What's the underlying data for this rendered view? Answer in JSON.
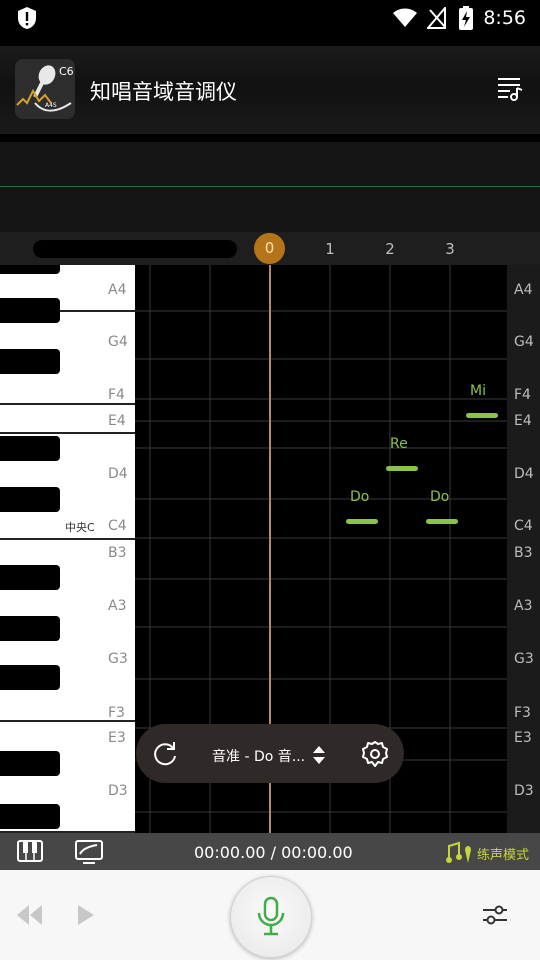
{
  "status_bar": {
    "time": "8:56"
  },
  "header": {
    "title": "知唱音域音调仪",
    "logo_text_top": "C6",
    "logo_text_bottom": "A4S"
  },
  "timeline": {
    "playhead": "0",
    "ticks": [
      "1",
      "2",
      "3"
    ]
  },
  "piano": {
    "labels": [
      "A4",
      "G4",
      "F4",
      "E4",
      "D4",
      "C4",
      "B3",
      "A3",
      "G3",
      "F3",
      "E3",
      "D3"
    ],
    "middle_c": "中央C"
  },
  "right_axis": {
    "labels": [
      "A4",
      "G4",
      "F4",
      "E4",
      "D4",
      "C4",
      "B3",
      "A3",
      "G3",
      "F3",
      "E3",
      "D3"
    ]
  },
  "notes": [
    {
      "name": "Do",
      "pitch": "C4",
      "time": 1.5
    },
    {
      "name": "Re",
      "pitch": "D4",
      "time": 2.2
    },
    {
      "name": "Do",
      "pitch": "C4",
      "time": 2.8
    },
    {
      "name": "Mi",
      "pitch": "E4",
      "time": 3.5
    }
  ],
  "float_bar": {
    "mode": "音准 - Do 音..."
  },
  "bottom_bar": {
    "timecode": "00:00.00 / 00:00.00",
    "practice_mode": "练声模式"
  },
  "colors": {
    "accent": "#8bc34a",
    "playhead": "#b6741a",
    "practice": "#c6d53a",
    "mic": "#3fae49"
  }
}
